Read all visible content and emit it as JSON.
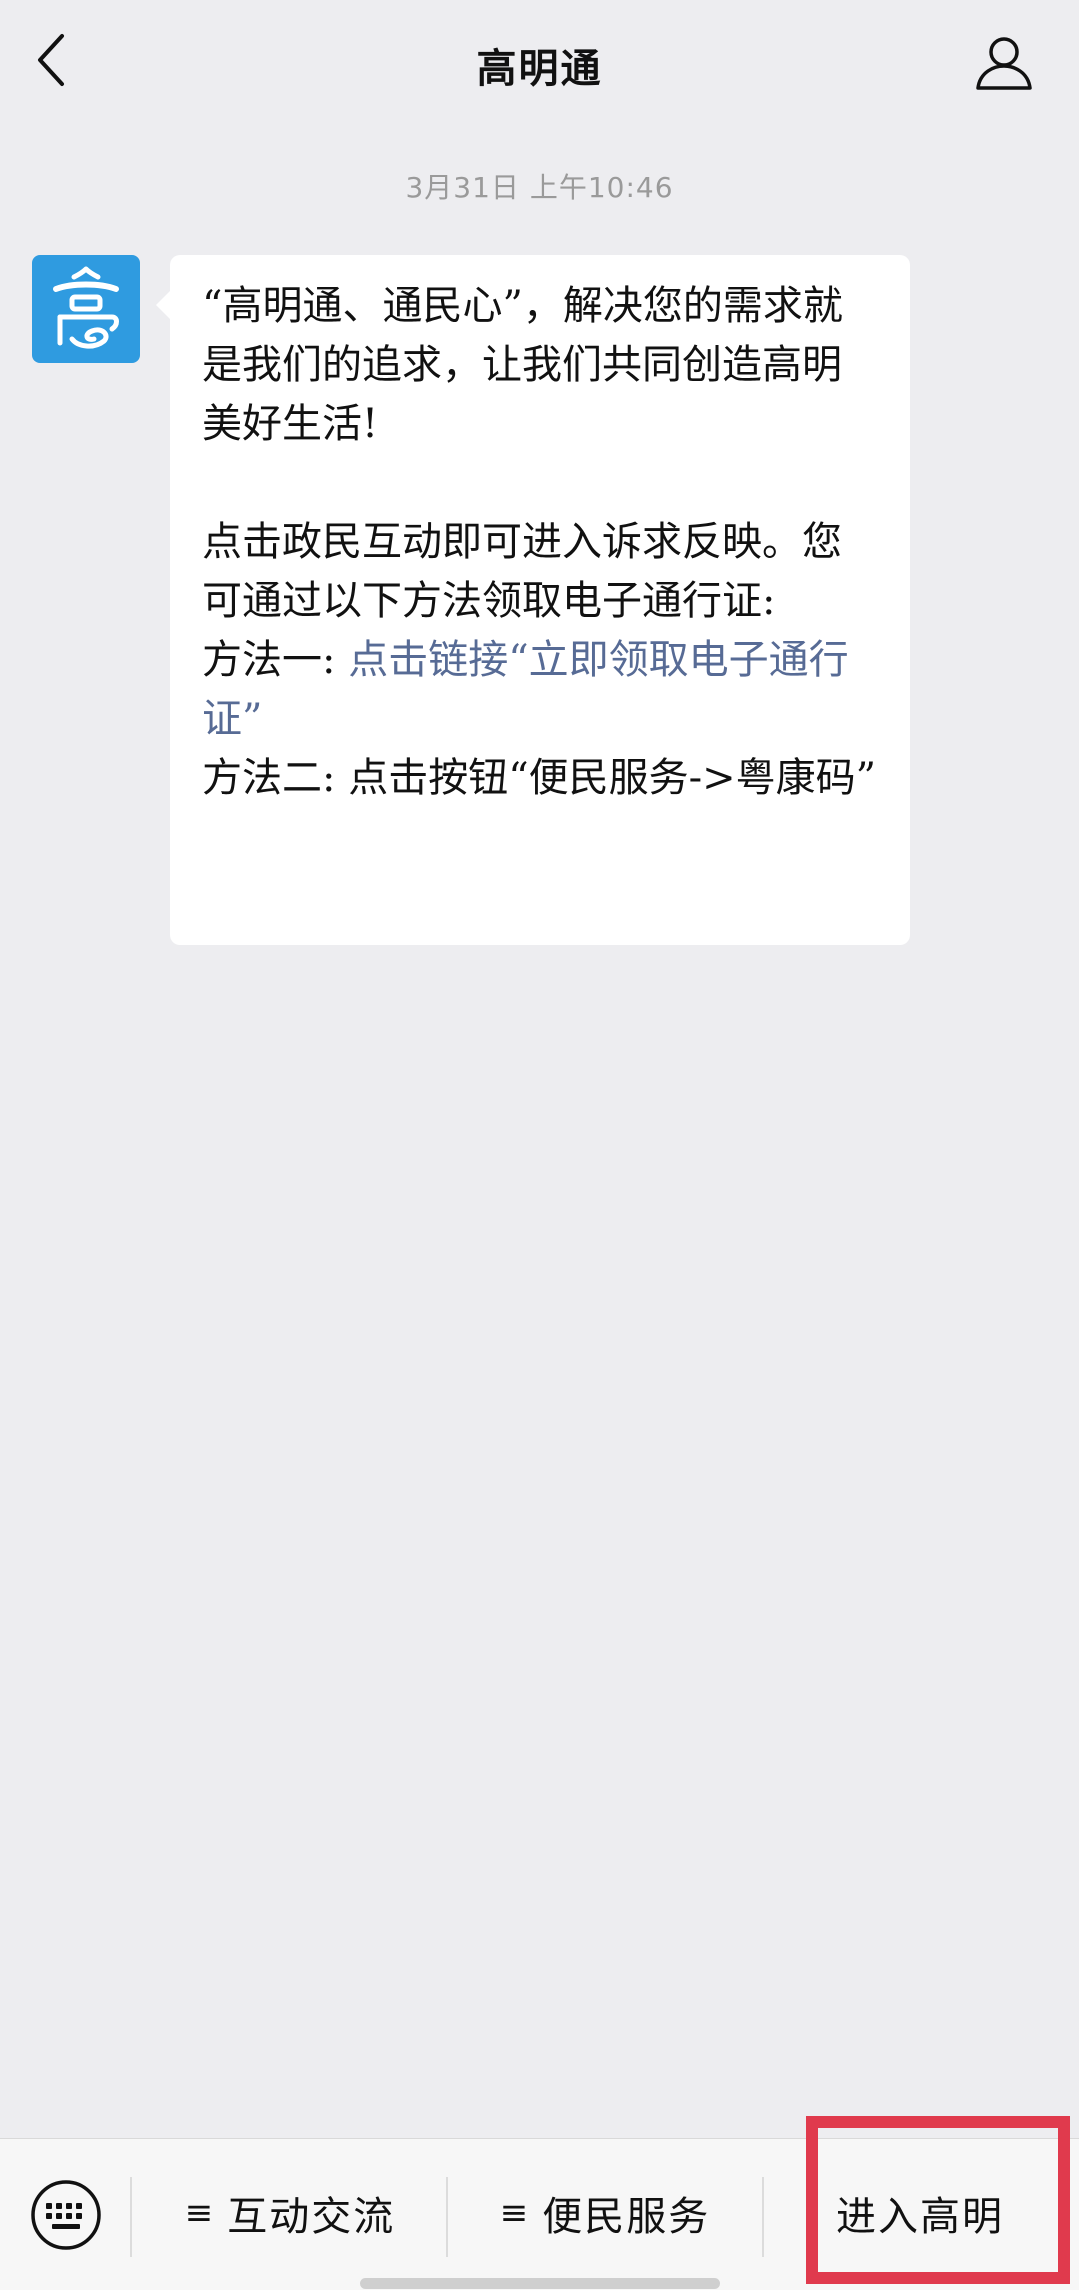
{
  "header": {
    "title": "高明通",
    "back_icon": "chevron-left-icon",
    "profile_icon": "person-icon"
  },
  "chat": {
    "timestamp": "3月31日 上午10:46",
    "avatar_icon": "gaoming-logo",
    "message": {
      "paragraph1": "“高明通、通民心”，解决您的需求就是我们的追求，让我们共同创造高明美好生活!",
      "paragraph2": "点击政民互动即可进入诉求反映。您可通过以下方法领取电子通行证:",
      "method1_prefix": "方法一:",
      "method1_link": "点击链接“立即领取电子通行证”",
      "method2": "方法二: 点击按钮“便民服务->粤康码”"
    }
  },
  "bottom_bar": {
    "keyboard_icon": "keyboard-icon",
    "menu_icon": "≡",
    "menu1_label": "互动交流",
    "menu2_label": "便民服务",
    "menu3_label": "进入高明"
  },
  "colors": {
    "link": "#576b95",
    "highlight_border": "#e03a4d",
    "avatar_bg": "#2f9be0"
  }
}
